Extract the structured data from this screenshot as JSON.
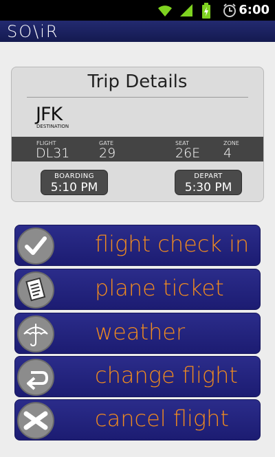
{
  "status_bar": {
    "time": "6:00",
    "icons": [
      "wifi-icon",
      "signal-icon",
      "battery-charging-icon",
      "alarm-icon"
    ]
  },
  "app": {
    "logo": "SO\\iR",
    "colors": {
      "header": "#1c2160",
      "accent": "#f28c1e",
      "button": "#23237c"
    }
  },
  "trip": {
    "title": "Trip Details",
    "destination_code": "JFK",
    "destination_label": "DESTINATION",
    "flight_label": "FLIGHT",
    "flight": "DL31",
    "gate_label": "GATE",
    "gate": "29",
    "seat_label": "SEAT",
    "seat": "26E",
    "zone_label": "ZONE",
    "zone": "4",
    "boarding_label": "BOARDING",
    "boarding_time": "5:10 PM",
    "depart_label": "DEPART",
    "depart_time": "5:30 PM"
  },
  "menu": [
    {
      "label": "flight check in",
      "icon": "checkmark-icon"
    },
    {
      "label": "plane ticket",
      "icon": "ticket-icon"
    },
    {
      "label": "weather",
      "icon": "umbrella-icon"
    },
    {
      "label": "change flight",
      "icon": "return-arrow-icon"
    },
    {
      "label": "cancel flight",
      "icon": "cancel-x-icon"
    }
  ]
}
